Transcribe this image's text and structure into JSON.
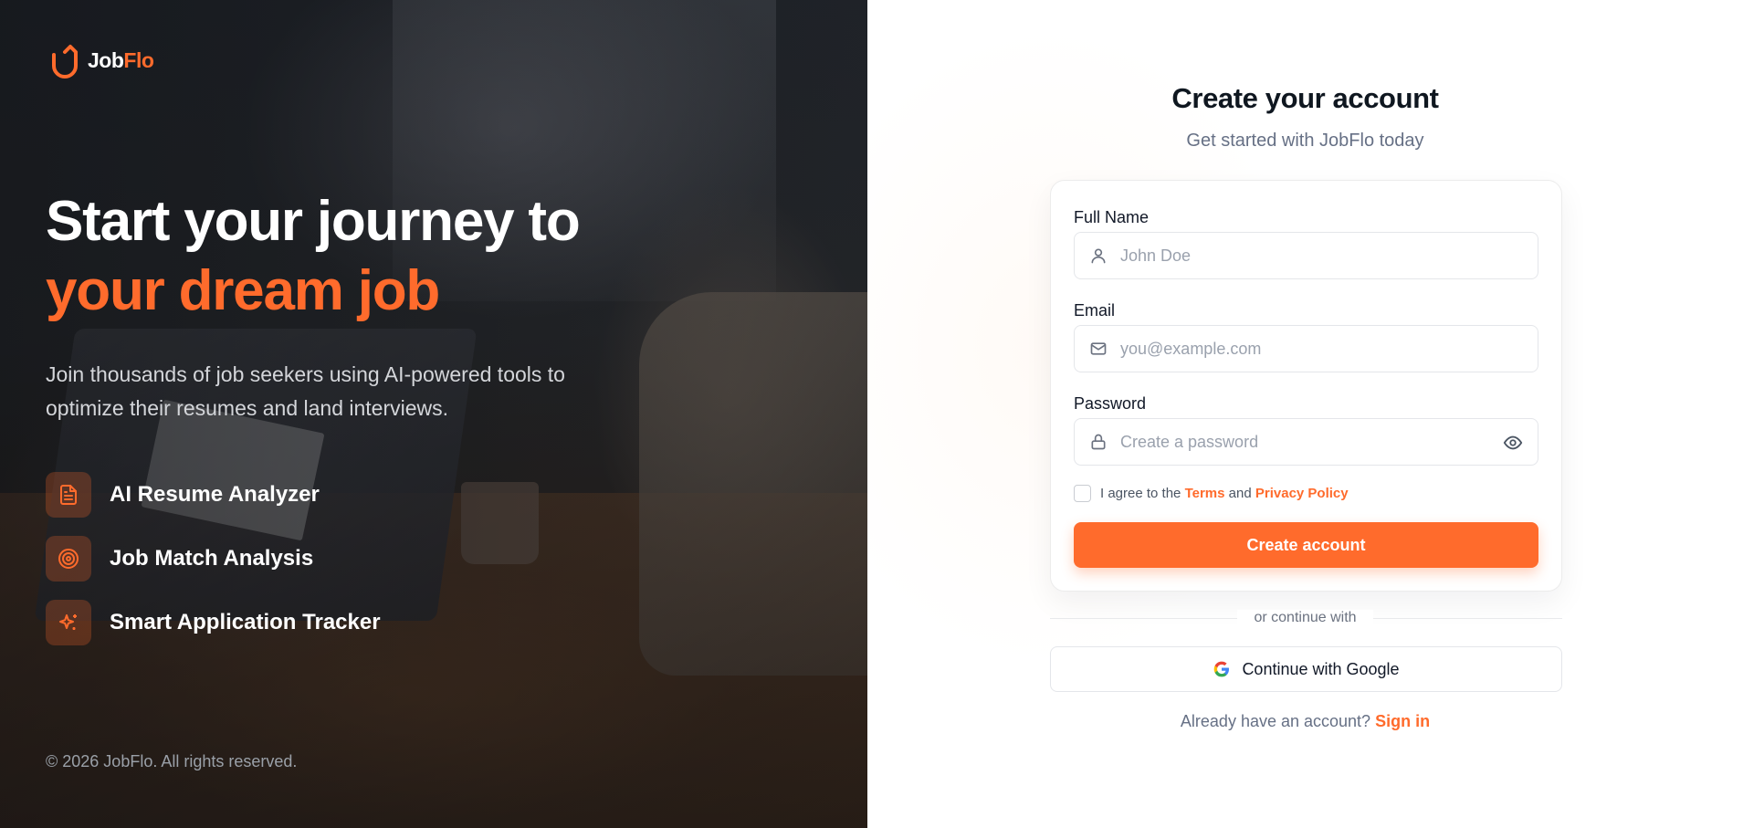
{
  "brand": {
    "name_prefix": "Job",
    "name_suffix": "Flo",
    "logo_icon": "upload-arrow-icon"
  },
  "hero": {
    "title_line1": "Start your journey to",
    "title_line2": "your dream job",
    "subtitle": "Join thousands of job seekers using AI-powered tools to optimize their resumes and land interviews.",
    "features": [
      {
        "label": "AI Resume Analyzer",
        "icon": "document-icon"
      },
      {
        "label": "Job Match Analysis",
        "icon": "target-icon"
      },
      {
        "label": "Smart Application Tracker",
        "icon": "sparkles-icon"
      }
    ],
    "copyright": "© 2026 JobFlo. All rights reserved."
  },
  "form": {
    "title": "Create your account",
    "subtitle": "Get started with JobFlo today",
    "full_name": {
      "label": "Full Name",
      "placeholder": "John Doe",
      "value": ""
    },
    "email": {
      "label": "Email",
      "placeholder": "you@example.com",
      "value": ""
    },
    "password": {
      "label": "Password",
      "placeholder": "Create a password",
      "value": ""
    },
    "agree": {
      "prefix": "I agree to the",
      "terms": "Terms",
      "and": "and",
      "privacy": "Privacy Policy",
      "checked": false
    },
    "submit_label": "Create account",
    "divider_text": "or continue with",
    "google_label": "Continue with Google",
    "signin_prompt": "Already have an account?",
    "signin_link": "Sign in"
  },
  "colors": {
    "accent": "#ff6b2c",
    "hero_bg": "#262a30",
    "text_dark": "#0f1720",
    "muted": "#667085"
  }
}
